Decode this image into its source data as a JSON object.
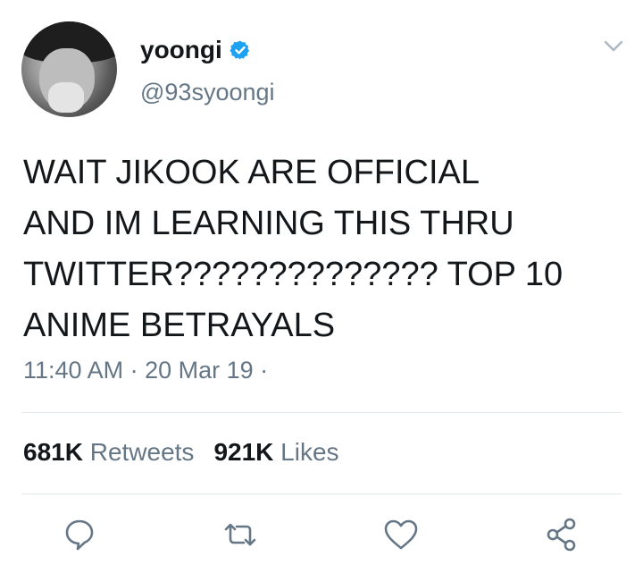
{
  "tweet": {
    "display_name": "yoongi",
    "handle": "@93syoongi",
    "text": "WAIT JIKOOK ARE OFFICIAL\nAND IM LEARNING THIS THRU\nTWITTER?????????????? TOP 10\nANIME BETRAYALS",
    "meta": "11:40 AM · 20 Mar 19 · "
  },
  "stats": {
    "retweets_count": "681K",
    "retweets_label": "Retweets",
    "likes_count": "921K",
    "likes_label": "Likes"
  },
  "colors": {
    "verified": "#1da1f2",
    "secondary_text": "#657786",
    "primary_text": "#14171a",
    "divider": "#e1e8ed"
  },
  "icons": {
    "verified": "verified-badge-icon",
    "menu": "chevron-down-icon",
    "reply": "reply-icon",
    "retweet": "retweet-icon",
    "like": "heart-icon",
    "share": "share-icon"
  }
}
